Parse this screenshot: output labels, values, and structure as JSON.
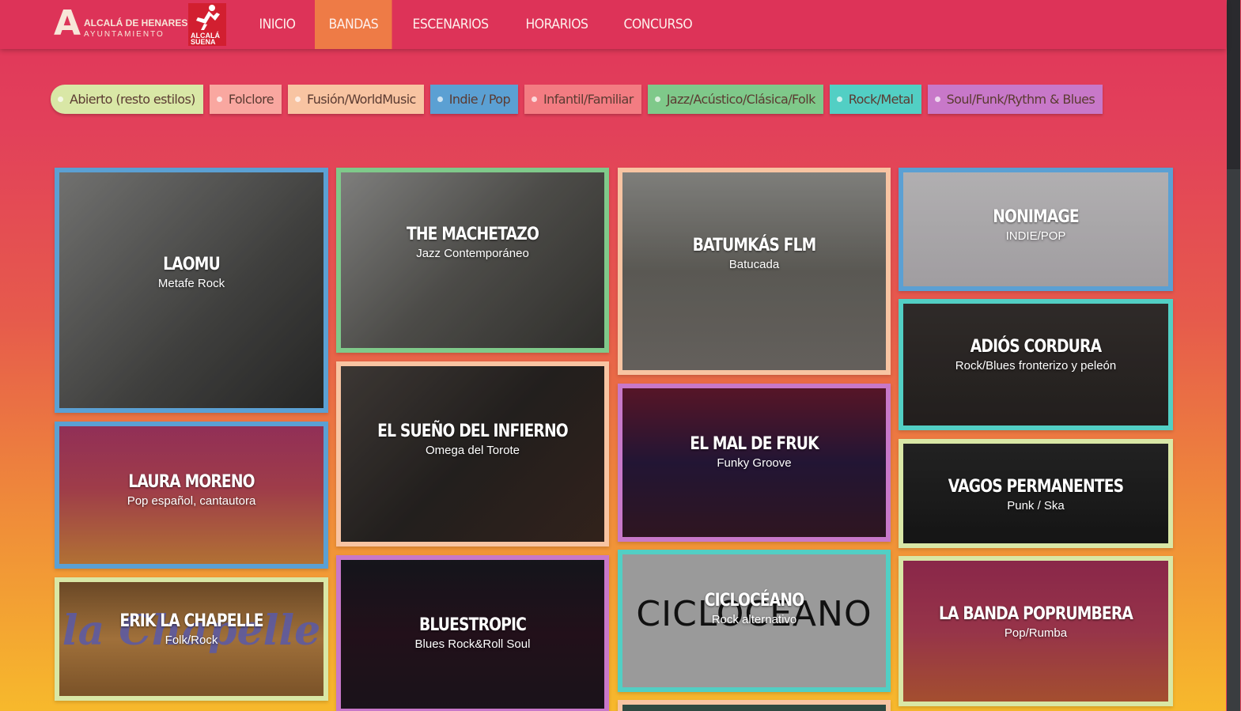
{
  "nav": {
    "logo_ayto": {
      "mark": "A",
      "line1": "ALCALÁ DE HENARES",
      "line2": "AYUNTAMIENTO"
    },
    "logo_suena": {
      "line1": "ALCALÁ",
      "line2": "SUENA"
    },
    "items": [
      {
        "label": "INICIO",
        "active": false
      },
      {
        "label": "BANDAS",
        "active": true
      },
      {
        "label": "ESCENARIOS",
        "active": false
      },
      {
        "label": "HORARIOS",
        "active": false
      },
      {
        "label": "CONCURSO",
        "active": false
      }
    ]
  },
  "filters": [
    {
      "label": "Abierto (resto estilos)",
      "color": "#d9e7a6"
    },
    {
      "label": "Folclore",
      "color": "#f9a7a0"
    },
    {
      "label": "Fusión/WorldMusic",
      "color": "#f8c4a2"
    },
    {
      "label": "Indie / Pop",
      "color": "#5ba0d3"
    },
    {
      "label": "Infantil/Familiar",
      "color": "#f37c82"
    },
    {
      "label": "Jazz/Acústico/Clásica/Folk",
      "color": "#7fc98a"
    },
    {
      "label": "Rock/Metal",
      "color": "#52cfc4"
    },
    {
      "label": "Soul/Funk/Rythm & Blues",
      "color": "#c878c9"
    }
  ],
  "bands": [
    {
      "name": "LAOMU",
      "genre": "Metafe Rock",
      "border": "#5ba0d3",
      "bg": "linear-gradient(135deg,#8a8a88,#4d4d4b 60%,#2e2e2d)",
      "logo": ""
    },
    {
      "name": "LAURA MORENO",
      "genre": "Pop español, cantautora",
      "border": "#5ba0d3",
      "bg": "linear-gradient(180deg,#b23a6a,#c24a5a 45%,#d88a40)",
      "logo": ""
    },
    {
      "name": "ERIK LA CHAPELLE",
      "genre": "Folk/Rock",
      "border": "#d9e7a6",
      "bg": "linear-gradient(180deg,#6a4826,#a0703a 50%,#7a5228)",
      "logo": "la Chapelle"
    },
    {
      "name": "THE MACHETAZO",
      "genre": "Jazz Contemporáneo",
      "border": "#7fc98a",
      "bg": "linear-gradient(135deg,#9a9a98,#5d5c58 50%,#3a3935)",
      "logo": ""
    },
    {
      "name": "EL SUEÑO DEL INFIERNO",
      "genre": "Omega del Torote",
      "border": "#f8c4a2",
      "bg": "linear-gradient(135deg,#4a4440,#2a2624 50%,#3d2a22)",
      "logo": ""
    },
    {
      "name": "BLUESTROPIC",
      "genre": "Blues Rock&Roll Soul",
      "border": "#c878c9",
      "bg": "linear-gradient(180deg,#1a1a22,#2a1420 50%,#201820)",
      "logo": ""
    },
    {
      "name": "BATUMKÁS FLM",
      "genre": "Batucada",
      "border": "#f8c4a2",
      "bg": "linear-gradient(180deg,#9a9a96,#6e6c66 50%,#7a7570)",
      "logo": ""
    },
    {
      "name": "EL MAL DE FRUK",
      "genre": "Funky Groove",
      "border": "#c878c9",
      "bg": "linear-gradient(180deg,#6a1a30,#2a1a40 50%,#3a1a28)",
      "logo": ""
    },
    {
      "name": "CICLOCÉANO",
      "genre": "Rock alternativo",
      "border": "#52cfc4",
      "bg": "#9a9a9a",
      "logo": "CICLOCEANO"
    },
    {
      "name": "",
      "genre": "",
      "border": "#f8c4a2",
      "bg": "#3a5a50",
      "logo": ""
    },
    {
      "name": "NONIMAGE",
      "genre": "INDIE/POP",
      "border": "#5ba0d3",
      "bg": "linear-gradient(180deg,#d8d6d8,#c4c0c4)",
      "logo": ""
    },
    {
      "name": "ADIÓS CORDURA",
      "genre": "Rock/Blues fronterizo y peleón",
      "border": "#52cfc4",
      "bg": "linear-gradient(180deg,#3a3432,#2a2624)",
      "logo": ""
    },
    {
      "name": "VAGOS PERMANENTES",
      "genre": "Punk / Ska",
      "border": "#d9e7a6",
      "bg": "linear-gradient(180deg,#2a2a2a,#1a1a1a)",
      "logo": ""
    },
    {
      "name": "LA BANDA POPRUMBERA",
      "genre": "Pop/Rumba",
      "border": "#d9e7a6",
      "bg": "linear-gradient(180deg,#a8305a,#b8405a 50%,#c8603a)",
      "logo": ""
    }
  ]
}
